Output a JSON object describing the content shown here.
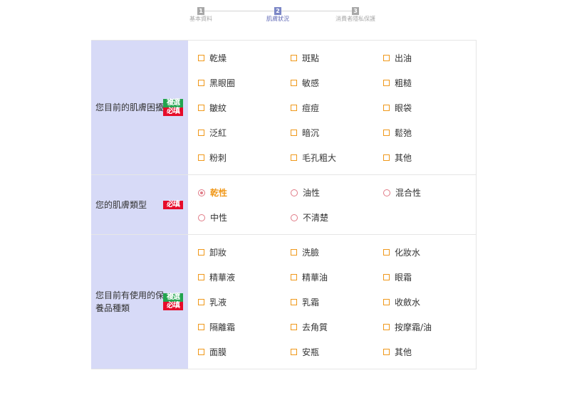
{
  "steps": [
    {
      "num": "1",
      "label": "基本資料",
      "active": false
    },
    {
      "num": "2",
      "label": "肌膚狀況",
      "active": true
    },
    {
      "num": "3",
      "label": "消費者隱私保護",
      "active": false
    }
  ],
  "badges": {
    "multi": "複選",
    "required": "必填"
  },
  "form": {
    "skin_concerns": {
      "label": "您目前的肌膚困擾",
      "options": [
        "乾燥",
        "斑點",
        "出油",
        "黑眼圈",
        "敏感",
        "粗糙",
        "皺紋",
        "痘痘",
        "眼袋",
        "泛紅",
        "暗沉",
        "鬆弛",
        "粉刺",
        "毛孔粗大",
        "其他"
      ]
    },
    "skin_type": {
      "label": "您的肌膚類型",
      "options": [
        "乾性",
        "油性",
        "混合性",
        "中性",
        "不清楚"
      ],
      "selected": "乾性"
    },
    "products": {
      "label": "您目前有使用的保養品種類",
      "options": [
        "卸妝",
        "洗臉",
        "化妝水",
        "精華液",
        "精華油",
        "眼霜",
        "乳液",
        "乳霜",
        "收斂水",
        "隔離霜",
        "去角質",
        "按摩霜/油",
        "面膜",
        "安瓶",
        "其他"
      ]
    }
  }
}
